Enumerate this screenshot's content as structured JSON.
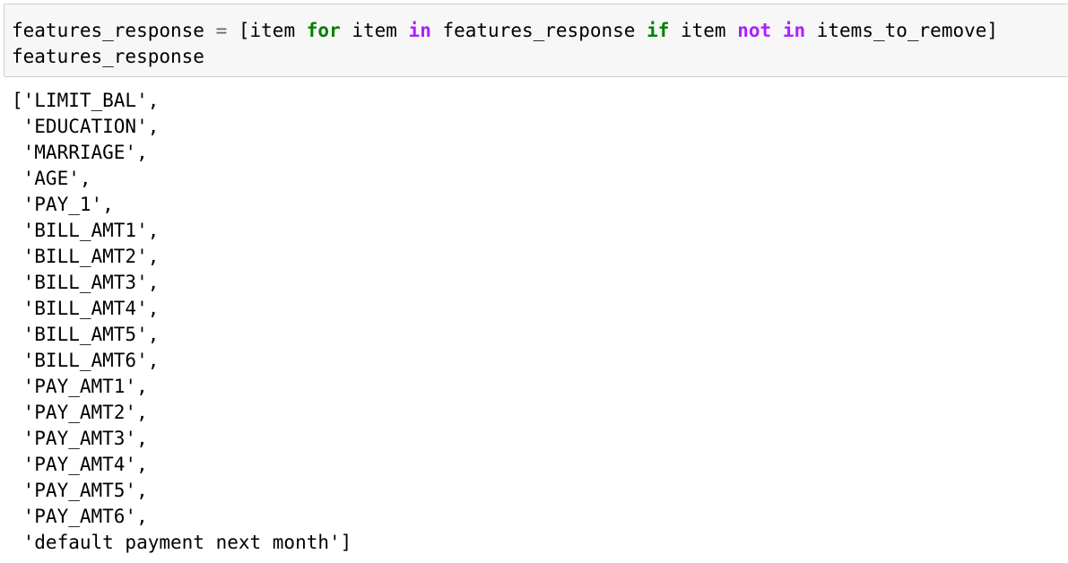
{
  "input_cell": {
    "line1": {
      "t1": "features_response ",
      "op_assign": "=",
      "t2": " [item ",
      "kw_for": "for",
      "t3": " item ",
      "kw_in1": "in",
      "t4": " features_response ",
      "kw_if": "if",
      "t5": " item ",
      "kw_not": "not",
      "t6": " ",
      "kw_in2": "in",
      "t7": " items_to_remove]"
    },
    "line2": "features_response"
  },
  "output": {
    "lines": [
      "['LIMIT_BAL',",
      " 'EDUCATION',",
      " 'MARRIAGE',",
      " 'AGE',",
      " 'PAY_1',",
      " 'BILL_AMT1',",
      " 'BILL_AMT2',",
      " 'BILL_AMT3',",
      " 'BILL_AMT4',",
      " 'BILL_AMT5',",
      " 'BILL_AMT6',",
      " 'PAY_AMT1',",
      " 'PAY_AMT2',",
      " 'PAY_AMT3',",
      " 'PAY_AMT4',",
      " 'PAY_AMT5',",
      " 'PAY_AMT6',",
      " 'default payment next month']"
    ]
  },
  "colors": {
    "keyword": "#008000",
    "operator": "#666666",
    "keyword_operator": "#aa22ff",
    "cell_background": "#f7f7f7",
    "cell_border": "#cfcfcf"
  }
}
